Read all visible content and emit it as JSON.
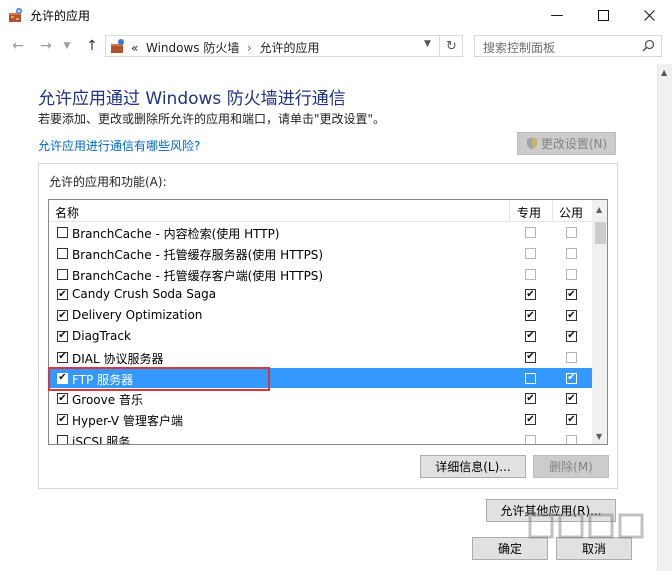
{
  "window": {
    "title": "允许的应用",
    "minimize_icon": "minimize-icon",
    "maximize_icon": "maximize-icon",
    "close_icon": "close-icon"
  },
  "nav": {
    "breadcrumb_prefix": "«",
    "breadcrumb": [
      "Windows 防火墙",
      "允许的应用"
    ],
    "search_placeholder": "搜索控制面板"
  },
  "content": {
    "heading": "允许应用通过 Windows 防火墙进行通信",
    "instruction": "若要添加、更改或删除所允许的应用和端口，请单击\"更改设置\"。",
    "risk_link": "允许应用进行通信有哪些风险?",
    "change_settings_label": "更改设置(N)"
  },
  "apps": {
    "group_title": "允许的应用和功能(A):",
    "columns": {
      "name": "名称",
      "private": "专用",
      "public": "公用"
    },
    "rows": [
      {
        "name": "BranchCache - 内容检索(使用 HTTP)",
        "enabled": false,
        "private": false,
        "public": false,
        "selected": false
      },
      {
        "name": "BranchCache - 托管缓存服务器(使用 HTTPS)",
        "enabled": false,
        "private": false,
        "public": false,
        "selected": false
      },
      {
        "name": "BranchCache - 托管缓存客户端(使用 HTTPS)",
        "enabled": false,
        "private": false,
        "public": false,
        "selected": false
      },
      {
        "name": "Candy Crush Soda Saga",
        "enabled": true,
        "private": true,
        "public": true,
        "selected": false
      },
      {
        "name": "Delivery Optimization",
        "enabled": true,
        "private": true,
        "public": true,
        "selected": false
      },
      {
        "name": "DiagTrack",
        "enabled": true,
        "private": true,
        "public": true,
        "selected": false
      },
      {
        "name": "DIAL 协议服务器",
        "enabled": true,
        "private": true,
        "public": false,
        "selected": false
      },
      {
        "name": "FTP 服务器",
        "enabled": true,
        "private": false,
        "public": true,
        "selected": true
      },
      {
        "name": "Groove 音乐",
        "enabled": true,
        "private": true,
        "public": true,
        "selected": false
      },
      {
        "name": "Hyper-V 管理客户端",
        "enabled": true,
        "private": true,
        "public": true,
        "selected": false
      },
      {
        "name": "iSCSI 服务",
        "enabled": false,
        "private": false,
        "public": false,
        "selected": false
      }
    ],
    "details_label": "详细信息(L)...",
    "remove_label": "删除(M)"
  },
  "footer": {
    "allow_other_label": "允许其他应用(R)...",
    "ok_label": "确定",
    "cancel_label": "取消"
  },
  "colors": {
    "heading": "#1e3287",
    "link": "#0066cc",
    "selection": "#3399ff",
    "highlight_box": "#d9363e"
  }
}
